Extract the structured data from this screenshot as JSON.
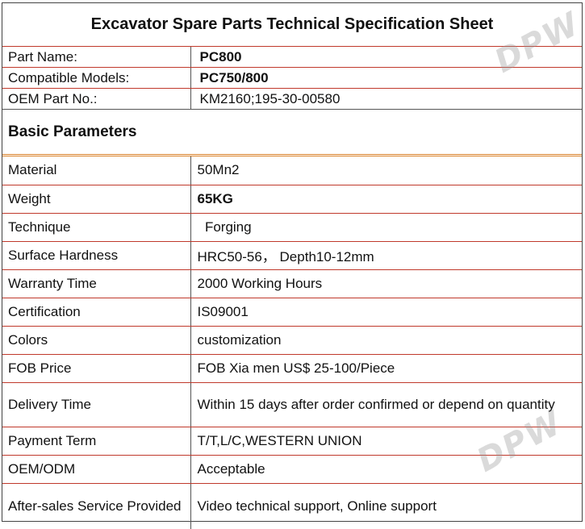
{
  "title": "Excavator Spare Parts Technical Specification Sheet",
  "top_rows": [
    {
      "label": "Part Name:",
      "value": "PC800",
      "bold": true
    },
    {
      "label": "Compatible Models:",
      "value": "PC750/800",
      "bold": true
    },
    {
      "label": "OEM Part No.:",
      "value": "KM2160;195-30-00580",
      "bold": false
    }
  ],
  "section_title": "Basic Parameters",
  "params": [
    {
      "label": "Material",
      "value": "50Mn2"
    },
    {
      "label": "Weight",
      "value": "65KG"
    },
    {
      "label": "Technique",
      "value": "  Forging"
    },
    {
      "label": "Surface Hardness",
      "value": "HRC50-56， Depth10-12mm"
    },
    {
      "label": "Warranty Time",
      "value": "2000 Working Hours"
    },
    {
      "label": "Certification",
      "value": "IS09001"
    },
    {
      "label": "Colors",
      "value": "customization"
    },
    {
      "label": "FOB Price",
      "value": "FOB Xia men US$ 25-100/Piece"
    },
    {
      "label": "Delivery Time",
      "value": "Within 15 days after order confirmed or depend on quantity"
    },
    {
      "label": "Payment Term",
      "value": "T/T,L/C,WESTERN UNION"
    },
    {
      "label": "OEM/ODM",
      "value": "Acceptable"
    },
    {
      "label": "After-sales Service Provided",
      "value": "Video technical support, Online support"
    }
  ],
  "watermark": "DPW",
  "colors": {
    "row_border": "#c0392b",
    "section_border": "#d9822b"
  }
}
